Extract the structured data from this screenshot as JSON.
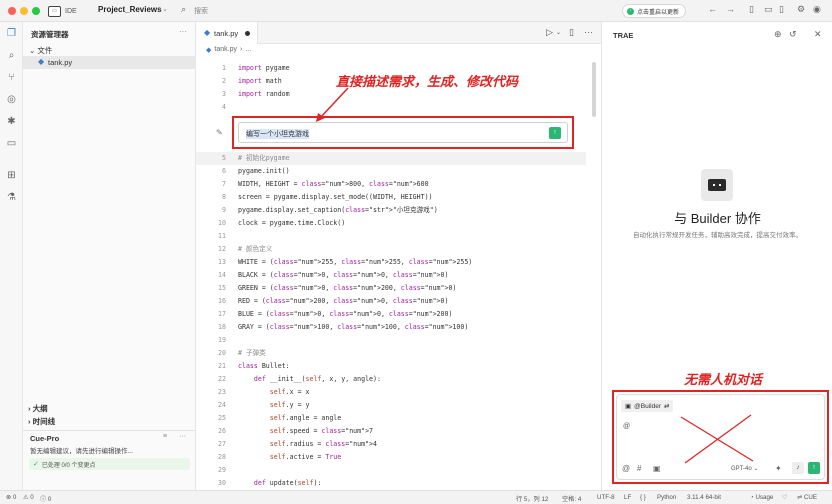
{
  "titlebar": {
    "ide_label": "IDE",
    "project_name": "Project_Reviews",
    "search_placeholder": "搜索",
    "update_notice": "点击重启以更新",
    "colors": {
      "close": "#ff5f57",
      "minimize": "#febc2e",
      "maximize": "#28c840",
      "accent": "#2bb673"
    }
  },
  "activity_bar": {
    "icons": [
      "explorer-icon",
      "search-icon",
      "source-control-icon",
      "run-debug-icon",
      "bug-icon",
      "remote-icon",
      "extensions-icon",
      "testing-icon"
    ]
  },
  "explorer": {
    "title": "资源管理器",
    "folder": "文件",
    "files": [
      "tank.py"
    ],
    "outline_label": "大纲",
    "timeline_label": "时间线",
    "cue": {
      "title": "Cue-Pro",
      "message": "暂无编辑建议，请先进行编辑操作...",
      "status": "已处理 0/0 个变更点"
    }
  },
  "editor": {
    "tab": "tank.py",
    "breadcrumb": [
      "tank.py",
      "..."
    ],
    "inline_prompt": "编写一个小坦克游戏",
    "annotation": "直接描述需求，生成、修改代码",
    "lines": [
      {
        "n": "1",
        "t": "import pygame"
      },
      {
        "n": "2",
        "t": "import math"
      },
      {
        "n": "3",
        "t": "import random"
      },
      {
        "n": "4",
        "t": ""
      },
      {
        "n": "5",
        "t": "# 初始化pygame"
      },
      {
        "n": "6",
        "t": "pygame.init()"
      },
      {
        "n": "7",
        "t": "WIDTH, HEIGHT = 800, 600"
      },
      {
        "n": "8",
        "t": "screen = pygame.display.set_mode((WIDTH, HEIGHT))"
      },
      {
        "n": "9",
        "t": "pygame.display.set_caption(\"小坦克游戏\")"
      },
      {
        "n": "10",
        "t": "clock = pygame.time.Clock()"
      },
      {
        "n": "11",
        "t": ""
      },
      {
        "n": "12",
        "t": "# 颜色定义"
      },
      {
        "n": "13",
        "t": "WHITE = (255, 255, 255)"
      },
      {
        "n": "14",
        "t": "BLACK = (0, 0, 0)"
      },
      {
        "n": "15",
        "t": "GREEN = (0, 200, 0)"
      },
      {
        "n": "16",
        "t": "RED = (200, 0, 0)"
      },
      {
        "n": "17",
        "t": "BLUE = (0, 0, 200)"
      },
      {
        "n": "18",
        "t": "GRAY = (100, 100, 100)"
      },
      {
        "n": "19",
        "t": ""
      },
      {
        "n": "20",
        "t": "# 子弹类"
      },
      {
        "n": "21",
        "t": "class Bullet:"
      },
      {
        "n": "22",
        "t": "    def __init__(self, x, y, angle):"
      },
      {
        "n": "23",
        "t": "        self.x = x"
      },
      {
        "n": "24",
        "t": "        self.y = y"
      },
      {
        "n": "25",
        "t": "        self.angle = angle"
      },
      {
        "n": "26",
        "t": "        self.speed = 7"
      },
      {
        "n": "27",
        "t": "        self.radius = 4"
      },
      {
        "n": "28",
        "t": "        self.active = True"
      },
      {
        "n": "29",
        "t": ""
      },
      {
        "n": "30",
        "t": "    def update(self):"
      }
    ]
  },
  "panel": {
    "title": "TRAE",
    "heading": "与 Builder 协作",
    "description": "自动化执行常规开发任务，辅助高效完成，提高交付效率。",
    "annotation": "无需人机对话",
    "chat": {
      "agent": "@Builder",
      "input": "@",
      "model": "GPT-4o"
    }
  },
  "statusbar": {
    "errors": "0",
    "warnings": "0",
    "info": "0",
    "position": "行 5，列 12",
    "spaces": "空格: 4",
    "encoding": "UTF-8",
    "eol": "LF",
    "braces": "{ }",
    "language": "Python",
    "interpreter": "3.11.4 64-bit",
    "usage": "Usage",
    "cue": "CUE"
  }
}
